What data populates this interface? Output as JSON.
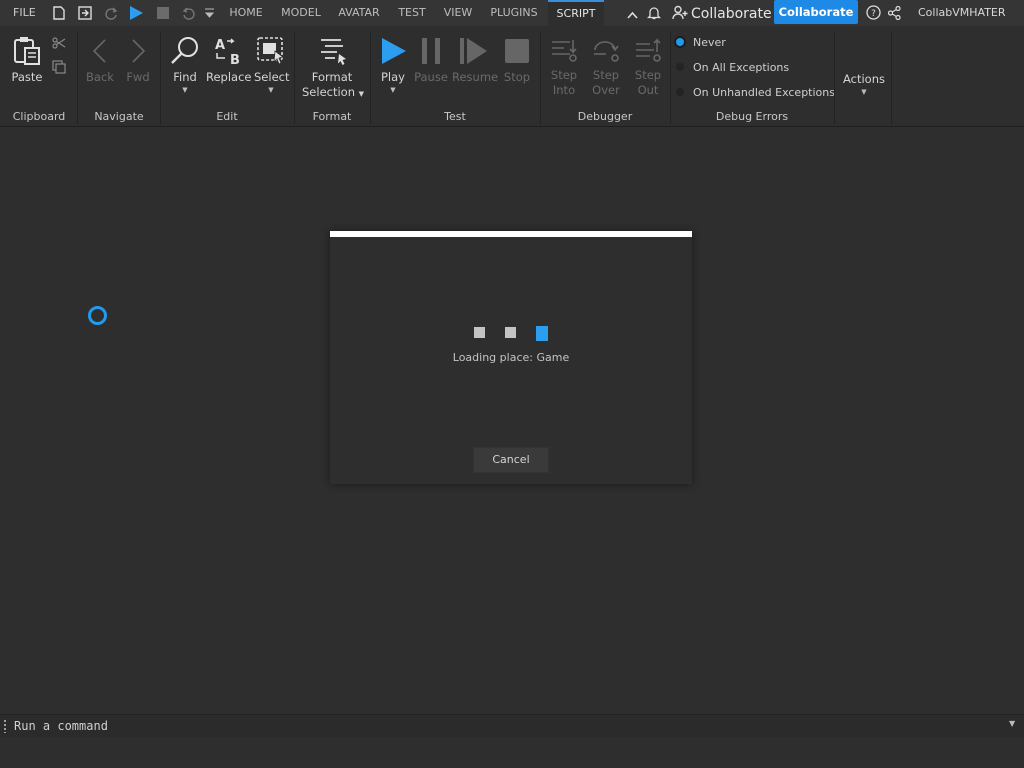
{
  "menubar": {
    "file_label": "FILE",
    "tabs": [
      "HOME",
      "MODEL",
      "AVATAR",
      "TEST",
      "VIEW",
      "PLUGINS",
      "SCRIPT"
    ],
    "active_tab": "SCRIPT",
    "collaborate_link": "Collaborate",
    "collaborate_button": "Collaborate",
    "username": "CollabVMHATER"
  },
  "ribbon": {
    "clipboard": {
      "group": "Clipboard",
      "paste": "Paste"
    },
    "navigate": {
      "group": "Navigate",
      "back": "Back",
      "fwd": "Fwd"
    },
    "edit": {
      "group": "Edit",
      "find": "Find",
      "replace": "Replace",
      "select": "Select"
    },
    "format": {
      "group": "Format",
      "format_line1": "Format",
      "format_line2": "Selection"
    },
    "test": {
      "group": "Test",
      "play": "Play",
      "pause": "Pause",
      "resume": "Resume",
      "stop": "Stop"
    },
    "debugger": {
      "group": "Debugger",
      "step_into_1": "Step",
      "step_into_2": "Into",
      "step_over_1": "Step",
      "step_over_2": "Over",
      "step_out_1": "Step",
      "step_out_2": "Out"
    },
    "debug_errors": {
      "group": "Debug Errors",
      "options": [
        "Never",
        "On All Exceptions",
        "On Unhandled Exceptions"
      ],
      "selected": "Never"
    },
    "actions": {
      "label": "Actions"
    }
  },
  "dialog": {
    "message": "Loading place: Game",
    "cancel": "Cancel"
  },
  "command_bar": {
    "placeholder": "Run a command"
  },
  "colors": {
    "accent": "#1e8ae6",
    "spinner": "#1f9bef",
    "background": "#2e2e2e"
  }
}
